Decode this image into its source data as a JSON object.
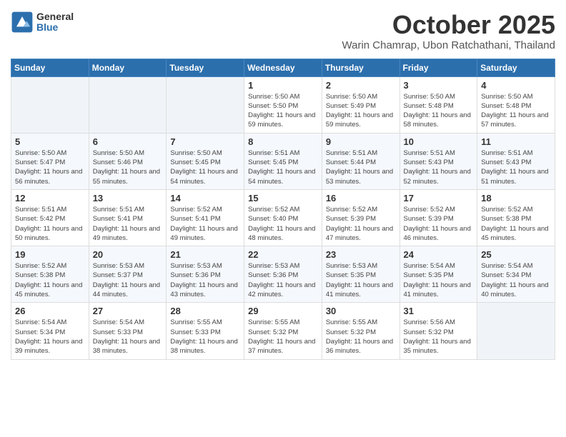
{
  "logo": {
    "general": "General",
    "blue": "Blue"
  },
  "header": {
    "month": "October 2025",
    "location": "Warin Chamrap, Ubon Ratchathani, Thailand"
  },
  "weekdays": [
    "Sunday",
    "Monday",
    "Tuesday",
    "Wednesday",
    "Thursday",
    "Friday",
    "Saturday"
  ],
  "weeks": [
    [
      {
        "day": "",
        "info": ""
      },
      {
        "day": "",
        "info": ""
      },
      {
        "day": "",
        "info": ""
      },
      {
        "day": "1",
        "info": "Sunrise: 5:50 AM\nSunset: 5:50 PM\nDaylight: 11 hours\nand 59 minutes."
      },
      {
        "day": "2",
        "info": "Sunrise: 5:50 AM\nSunset: 5:49 PM\nDaylight: 11 hours\nand 59 minutes."
      },
      {
        "day": "3",
        "info": "Sunrise: 5:50 AM\nSunset: 5:48 PM\nDaylight: 11 hours\nand 58 minutes."
      },
      {
        "day": "4",
        "info": "Sunrise: 5:50 AM\nSunset: 5:48 PM\nDaylight: 11 hours\nand 57 minutes."
      }
    ],
    [
      {
        "day": "5",
        "info": "Sunrise: 5:50 AM\nSunset: 5:47 PM\nDaylight: 11 hours\nand 56 minutes."
      },
      {
        "day": "6",
        "info": "Sunrise: 5:50 AM\nSunset: 5:46 PM\nDaylight: 11 hours\nand 55 minutes."
      },
      {
        "day": "7",
        "info": "Sunrise: 5:50 AM\nSunset: 5:45 PM\nDaylight: 11 hours\nand 54 minutes."
      },
      {
        "day": "8",
        "info": "Sunrise: 5:51 AM\nSunset: 5:45 PM\nDaylight: 11 hours\nand 54 minutes."
      },
      {
        "day": "9",
        "info": "Sunrise: 5:51 AM\nSunset: 5:44 PM\nDaylight: 11 hours\nand 53 minutes."
      },
      {
        "day": "10",
        "info": "Sunrise: 5:51 AM\nSunset: 5:43 PM\nDaylight: 11 hours\nand 52 minutes."
      },
      {
        "day": "11",
        "info": "Sunrise: 5:51 AM\nSunset: 5:43 PM\nDaylight: 11 hours\nand 51 minutes."
      }
    ],
    [
      {
        "day": "12",
        "info": "Sunrise: 5:51 AM\nSunset: 5:42 PM\nDaylight: 11 hours\nand 50 minutes."
      },
      {
        "day": "13",
        "info": "Sunrise: 5:51 AM\nSunset: 5:41 PM\nDaylight: 11 hours\nand 49 minutes."
      },
      {
        "day": "14",
        "info": "Sunrise: 5:52 AM\nSunset: 5:41 PM\nDaylight: 11 hours\nand 49 minutes."
      },
      {
        "day": "15",
        "info": "Sunrise: 5:52 AM\nSunset: 5:40 PM\nDaylight: 11 hours\nand 48 minutes."
      },
      {
        "day": "16",
        "info": "Sunrise: 5:52 AM\nSunset: 5:39 PM\nDaylight: 11 hours\nand 47 minutes."
      },
      {
        "day": "17",
        "info": "Sunrise: 5:52 AM\nSunset: 5:39 PM\nDaylight: 11 hours\nand 46 minutes."
      },
      {
        "day": "18",
        "info": "Sunrise: 5:52 AM\nSunset: 5:38 PM\nDaylight: 11 hours\nand 45 minutes."
      }
    ],
    [
      {
        "day": "19",
        "info": "Sunrise: 5:52 AM\nSunset: 5:38 PM\nDaylight: 11 hours\nand 45 minutes."
      },
      {
        "day": "20",
        "info": "Sunrise: 5:53 AM\nSunset: 5:37 PM\nDaylight: 11 hours\nand 44 minutes."
      },
      {
        "day": "21",
        "info": "Sunrise: 5:53 AM\nSunset: 5:36 PM\nDaylight: 11 hours\nand 43 minutes."
      },
      {
        "day": "22",
        "info": "Sunrise: 5:53 AM\nSunset: 5:36 PM\nDaylight: 11 hours\nand 42 minutes."
      },
      {
        "day": "23",
        "info": "Sunrise: 5:53 AM\nSunset: 5:35 PM\nDaylight: 11 hours\nand 41 minutes."
      },
      {
        "day": "24",
        "info": "Sunrise: 5:54 AM\nSunset: 5:35 PM\nDaylight: 11 hours\nand 41 minutes."
      },
      {
        "day": "25",
        "info": "Sunrise: 5:54 AM\nSunset: 5:34 PM\nDaylight: 11 hours\nand 40 minutes."
      }
    ],
    [
      {
        "day": "26",
        "info": "Sunrise: 5:54 AM\nSunset: 5:34 PM\nDaylight: 11 hours\nand 39 minutes."
      },
      {
        "day": "27",
        "info": "Sunrise: 5:54 AM\nSunset: 5:33 PM\nDaylight: 11 hours\nand 38 minutes."
      },
      {
        "day": "28",
        "info": "Sunrise: 5:55 AM\nSunset: 5:33 PM\nDaylight: 11 hours\nand 38 minutes."
      },
      {
        "day": "29",
        "info": "Sunrise: 5:55 AM\nSunset: 5:32 PM\nDaylight: 11 hours\nand 37 minutes."
      },
      {
        "day": "30",
        "info": "Sunrise: 5:55 AM\nSunset: 5:32 PM\nDaylight: 11 hours\nand 36 minutes."
      },
      {
        "day": "31",
        "info": "Sunrise: 5:56 AM\nSunset: 5:32 PM\nDaylight: 11 hours\nand 35 minutes."
      },
      {
        "day": "",
        "info": ""
      }
    ]
  ]
}
